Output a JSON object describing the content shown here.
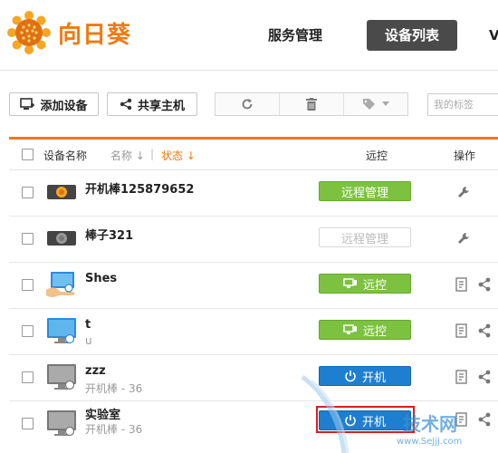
{
  "brand": {
    "name": "向日葵",
    "color": "#f07a10"
  },
  "nav": {
    "items": [
      "服务管理",
      "设备列表",
      "V"
    ],
    "active_index": 1
  },
  "toolbar": {
    "add_label": "添加设备",
    "share_label": "共享主机",
    "tag_placeholder": "我的标签",
    "icons": [
      "refresh-icon",
      "trash-icon",
      "tag-icon"
    ]
  },
  "table": {
    "headers": {
      "name": "设备名称",
      "sort_name": "名称 ↓",
      "separator": "|",
      "sort_status": "状态 ↓",
      "remote": "远控",
      "ops": "操作"
    },
    "rows": [
      {
        "name": "开机棒125879652",
        "sub": "",
        "icon": "power-stick-icon",
        "action": "远程管理",
        "action_style": "green",
        "action_icon": "",
        "ops": [
          "wrench"
        ]
      },
      {
        "name": "棒子321",
        "sub": "",
        "icon": "power-stick-gray-icon",
        "action": "远程管理",
        "action_style": "disabled",
        "action_icon": "",
        "ops": [
          "wrench"
        ]
      },
      {
        "name": "Shes",
        "sub": "",
        "icon": "shared-pc-icon",
        "action": "远控",
        "action_style": "green",
        "action_icon": "monitor",
        "ops": [
          "log",
          "share"
        ]
      },
      {
        "name": "t",
        "sub": "u",
        "icon": "pc-online-icon",
        "action": "远控",
        "action_style": "green",
        "action_icon": "monitor",
        "ops": [
          "log",
          "share"
        ]
      },
      {
        "name": "zzz",
        "sub": "开机棒 - 36",
        "icon": "pc-offline-icon",
        "action": "开机",
        "action_style": "blue",
        "action_icon": "power",
        "ops": [
          "log",
          "share"
        ]
      },
      {
        "name": "实验室",
        "sub": "开机棒 - 36",
        "icon": "pc-offline-icon",
        "action": "开机",
        "action_style": "blue",
        "action_icon": "power",
        "ops": [
          "log",
          "share"
        ],
        "highlighted": true
      }
    ]
  },
  "watermark": {
    "text": "技术网",
    "url": "www.SeJjj.com"
  }
}
